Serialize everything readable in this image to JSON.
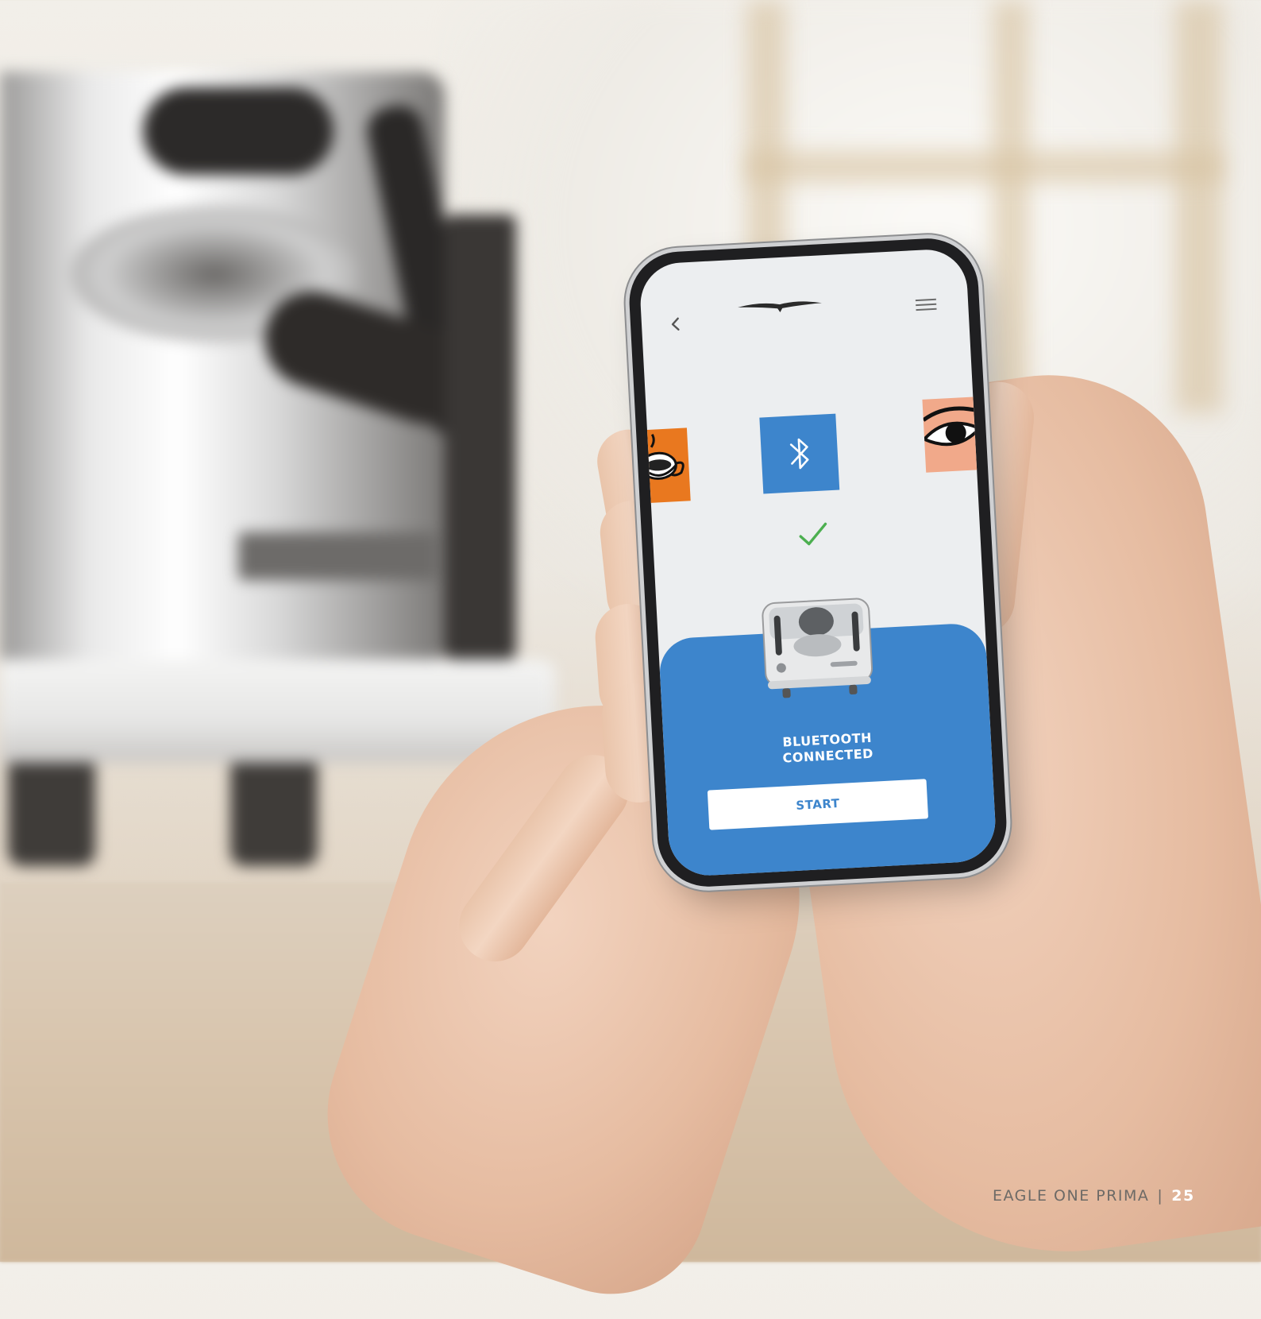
{
  "phone_app": {
    "header": {
      "back_icon": "chevron-left-icon",
      "logo_icon": "brand-wing-logo",
      "menu_icon": "hamburger-menu-icon"
    },
    "bluetooth_icon": "bluetooth-icon",
    "check_icon": "check-icon",
    "status_line1": "BLUETOOTH",
    "status_line2": "CONNECTED",
    "start_button": "START",
    "colors": {
      "primary_blue": "#3d85cc",
      "accent_orange": "#e9781f",
      "check_green": "#4caf50"
    }
  },
  "footer": {
    "title": "EAGLE ONE PRIMA",
    "separator": "|",
    "page_number": "25"
  }
}
